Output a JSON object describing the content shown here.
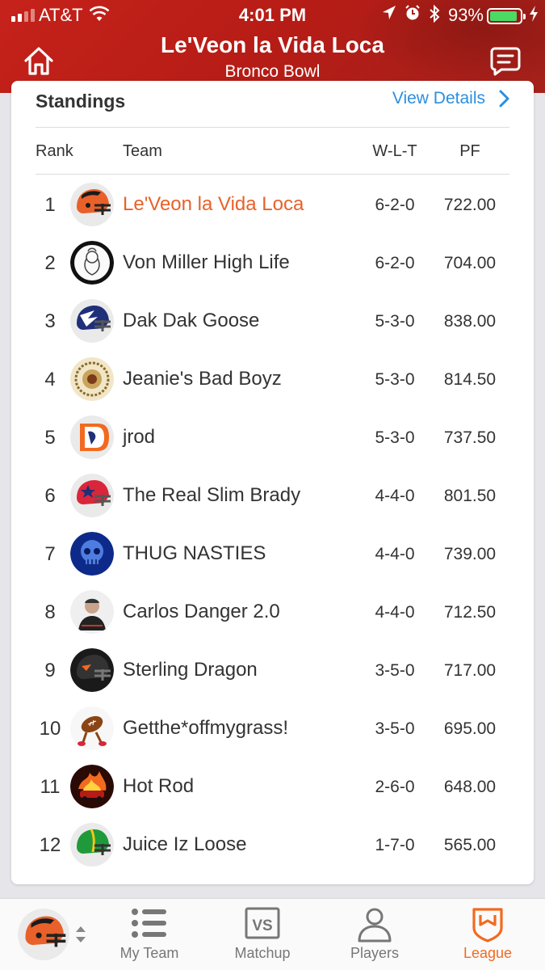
{
  "status_bar": {
    "carrier": "AT&T",
    "time": "4:01 PM",
    "battery_percent": "93%",
    "battery_level": 0.93,
    "icons": [
      "signal-icon",
      "wifi-icon",
      "location-icon",
      "alarm-icon",
      "bluetooth-icon",
      "battery-icon",
      "charging-icon"
    ]
  },
  "header": {
    "title": "Le'Veon la Vida Loca",
    "subtitle": "Bronco Bowl",
    "left_icon": "home-icon",
    "right_icon": "chat-icon"
  },
  "standings": {
    "title": "Standings",
    "view_details_label": "View Details",
    "columns": {
      "rank": "Rank",
      "team": "Team",
      "wlt": "W-L-T",
      "pf": "PF"
    },
    "rows": [
      {
        "rank": "1",
        "team": "Le'Veon la Vida Loca",
        "wlt": "6-2-0",
        "pf": "722.00",
        "mine": true,
        "avatar": "orange-black-helmet-icon"
      },
      {
        "rank": "2",
        "team": "Von Miller High Life",
        "wlt": "6-2-0",
        "pf": "704.00",
        "avatar": "sketch-portrait-avatar"
      },
      {
        "rank": "3",
        "team": "Dak Dak Goose",
        "wlt": "5-3-0",
        "pf": "838.00",
        "avatar": "blue-bird-helmet-icon"
      },
      {
        "rank": "4",
        "team": "Jeanie's Bad Boyz",
        "wlt": "5-3-0",
        "pf": "814.50",
        "avatar": "ornate-emblem-avatar"
      },
      {
        "rank": "5",
        "team": "jrod",
        "wlt": "5-3-0",
        "pf": "737.50",
        "avatar": "bronco-logo-avatar"
      },
      {
        "rank": "6",
        "team": "The Real Slim Brady",
        "wlt": "4-4-0",
        "pf": "801.50",
        "avatar": "red-star-helmet-icon"
      },
      {
        "rank": "7",
        "team": "THUG NASTIES",
        "wlt": "4-4-0",
        "pf": "739.00",
        "avatar": "blue-skull-avatar"
      },
      {
        "rank": "8",
        "team": "Carlos Danger 2.0",
        "wlt": "4-4-0",
        "pf": "712.50",
        "avatar": "man-portrait-avatar"
      },
      {
        "rank": "9",
        "team": "Sterling Dragon",
        "wlt": "3-5-0",
        "pf": "717.00",
        "avatar": "dark-helmet-icon"
      },
      {
        "rank": "10",
        "team": "Getthe*offmygrass!",
        "wlt": "3-5-0",
        "pf": "695.00",
        "avatar": "football-mascot-avatar"
      },
      {
        "rank": "11",
        "team": "Hot Rod",
        "wlt": "2-6-0",
        "pf": "648.00",
        "avatar": "flaming-car-avatar"
      },
      {
        "rank": "12",
        "team": "Juice Iz Loose",
        "wlt": "1-7-0",
        "pf": "565.00",
        "avatar": "green-helmet-icon"
      }
    ]
  },
  "tabbar": {
    "tabs": [
      {
        "label": "My Team",
        "icon": "list-icon",
        "active": false
      },
      {
        "label": "Matchup",
        "icon": "vs-icon",
        "active": false
      },
      {
        "label": "Players",
        "icon": "person-icon",
        "active": false
      },
      {
        "label": "League",
        "icon": "league-shield-icon",
        "active": true
      }
    ],
    "team_switcher_icon": "orange-black-helmet-icon"
  },
  "colors": {
    "header_red": "#c5221a",
    "accent_orange": "#e8612a",
    "link_blue": "#2b8fe0",
    "active_tab_orange": "#f26a1f"
  }
}
